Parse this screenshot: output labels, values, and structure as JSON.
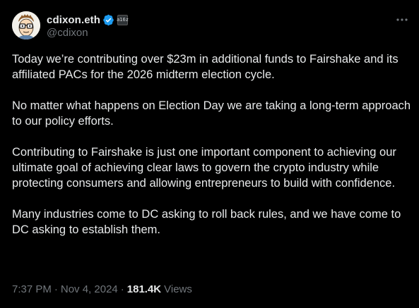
{
  "author": {
    "display_name": "cdixon.eth",
    "handle": "@cdixon",
    "avatar_icon": "cartoon-face-with-glasses-avatar",
    "verified_icon": "verified-badge-icon",
    "verified_color": "#1d9bf0",
    "affiliate_icon": "affiliate-badge-icon",
    "affiliate_text": "a16z"
  },
  "menu": {
    "more_icon": "more-horizontal-icon"
  },
  "tweet": {
    "paragraphs": [
      "Today we’re contributing over $23m in additional funds to Fairshake and its affiliated PACs for the 2026 midterm election cycle.",
      "No matter what happens on Election Day we are taking a long-term approach to our policy efforts.",
      "Contributing to Fairshake is just one important component to achieving our ultimate goal of achieving clear laws to govern the crypto industry while protecting consumers and allowing entrepreneurs to build with confidence.",
      "Many industries come to DC asking to roll back rules, and we have come to DC asking to establish them."
    ],
    "time": "7:37 PM",
    "separator": "·",
    "date": "Nov 4, 2024",
    "views_count": "181.4K",
    "views_label": "Views"
  },
  "colors": {
    "background": "#000000",
    "text_primary": "#e7e9ea",
    "text_secondary": "#71767b"
  }
}
